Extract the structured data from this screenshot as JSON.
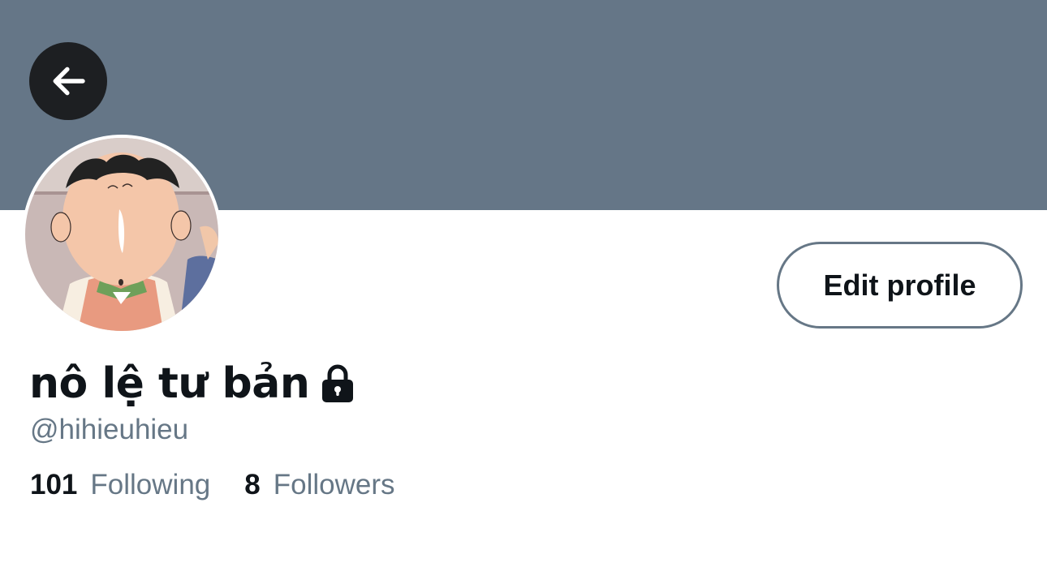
{
  "colors": {
    "banner": "#657687",
    "back_button_bg": "#1d1f22",
    "back_button_icon": "#ffffff",
    "text_primary": "#0f1419",
    "text_secondary": "#667786",
    "button_border": "#667786"
  },
  "header": {
    "back_icon": "arrow-left-icon"
  },
  "profile": {
    "display_name": "nô lệ tư bản",
    "protected_icon": "lock-icon",
    "handle": "@hihieuhieu",
    "edit_button_label": "Edit profile"
  },
  "stats": [
    {
      "count": "101",
      "label": "Following"
    },
    {
      "count": "8",
      "label": "Followers"
    }
  ]
}
